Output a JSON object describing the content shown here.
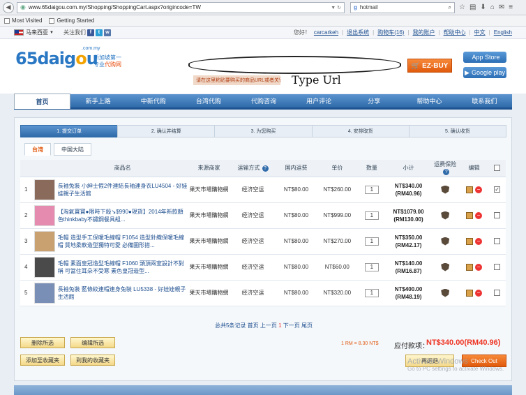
{
  "browser": {
    "url": "www.65daigou.com.my/Shopping/ShoppingCart.aspx?origincode=TW",
    "search_query": "hotmail",
    "bookmarks": [
      "Most Visited",
      "Getting Started"
    ]
  },
  "top_strip": {
    "country": "马来西亚",
    "follow": "关注我们",
    "links": [
      "您好！",
      "carcarkeh",
      "退出系统",
      "购物车(16)",
      "我的账户",
      "帮助中心",
      "中文",
      "English"
    ]
  },
  "header": {
    "logo_main": "65daig",
    "logo_o": "o",
    "logo_end": "u",
    "logo_domain": ".com.my",
    "logo_cn_1": "新加坡第一",
    "logo_cn_2a": "专业",
    "logo_cn_2b": "代购网",
    "ezbuy_label": "EZ-BUY",
    "hint": "请在这里粘贴要购买的商品URL或者关键字",
    "type_url": "Type Url",
    "app_store": "App Store",
    "google_play": "Google play"
  },
  "nav": [
    "首页",
    "新手上路",
    "中新代购",
    "台湾代购",
    "代购咨询",
    "用户评论",
    "分享",
    "帮助中心",
    "联系我们"
  ],
  "steps": [
    "1. 提交订单",
    "2. 确认并结算",
    "3. 为您购买",
    "4. 安排取货",
    "5. 确认收货"
  ],
  "region_tabs": [
    "台湾",
    "中国大陆"
  ],
  "columns": [
    "商品名",
    "来源商家",
    "运输方式",
    "国内运费",
    "单价",
    "数量",
    "小计",
    "运费保险",
    "编辑"
  ],
  "rows": [
    {
      "no": "1",
      "name": "長袖兔裝 小紳士假2件連結長袖連身衣LU4504 - 好娃娃親子生活館",
      "seller": "果天市場購物網",
      "ship": "经济空运",
      "fee": "NT$80.00",
      "price": "NT$260.00",
      "qty": "1",
      "sub1": "NT$340.00",
      "sub2": "(RM40.96)",
      "checked": true,
      "thumb": "#8a6a5a"
    },
    {
      "no": "2",
      "name": "【淘氣寶寶●限時下殺↘$990●現貨】2014年新款顏色thinkbaby不鏽鋼餐具組...",
      "seller": "果天市場購物網",
      "ship": "经济空运",
      "fee": "NT$80.00",
      "price": "NT$999.00",
      "qty": "1",
      "sub1": "NT$1079.00",
      "sub2": "(RM130.00)",
      "checked": false,
      "thumb": "#e58bb0"
    },
    {
      "no": "3",
      "name": "毛帽 造型手工保暖毛線帽 F1054 造型針織保暖毛線帽 質地柔軟造型獨特可愛 必備圖形搭...",
      "seller": "果天市場購物網",
      "ship": "经济空运",
      "fee": "NT$80.00",
      "price": "NT$270.00",
      "qty": "1",
      "sub1": "NT$350.00",
      "sub2": "(RM42.17)",
      "checked": false,
      "thumb": "#c9a070"
    },
    {
      "no": "4",
      "name": "毛帽 素面皇冠造型毛線帽 F1060 頭頂兩室設計不對稱 可當住耳朵不受寒 素色皇冠造型...",
      "seller": "果天市場購物網",
      "ship": "经济空运",
      "fee": "NT$80.00",
      "price": "NT$60.00",
      "qty": "1",
      "sub1": "NT$140.00",
      "sub2": "(RM16.87)",
      "checked": false,
      "thumb": "#4a4a4a"
    },
    {
      "no": "5",
      "name": "長袖兔裝 藍條紋連帽連身兔裝 LU5338 - 好娃娃親子生活館",
      "seller": "果天市場購物網",
      "ship": "经济空运",
      "fee": "NT$80.00",
      "price": "NT$320.00",
      "qty": "1",
      "sub1": "NT$400.00",
      "sub2": "(RM48.19)",
      "checked": false,
      "thumb": "#7a8fb5"
    }
  ],
  "pager": {
    "prefix": "总共5条记录 首页 上一页 ",
    "current": "1",
    "suffix": " 下一页 尾页"
  },
  "actions": {
    "delete_selected": "删除所选",
    "edit_selected": "编辑所选",
    "add_favorite": "添加至收藏夹",
    "to_favorite": "到我的收藏夹",
    "rate": "1 RM = 8.30 NT$",
    "pay_label": "应付款项：",
    "pay_amount": "NT$340.00(RM40.96)",
    "back": "再逛逛",
    "checkout": "Check Out"
  },
  "watermark": {
    "line1": "Activate Windows",
    "line2": "Go to PC settings to activate Windows."
  },
  "colors": {
    "accent": "#2f6aa9",
    "orange": "#e15a0c",
    "price_red": "#e32"
  }
}
